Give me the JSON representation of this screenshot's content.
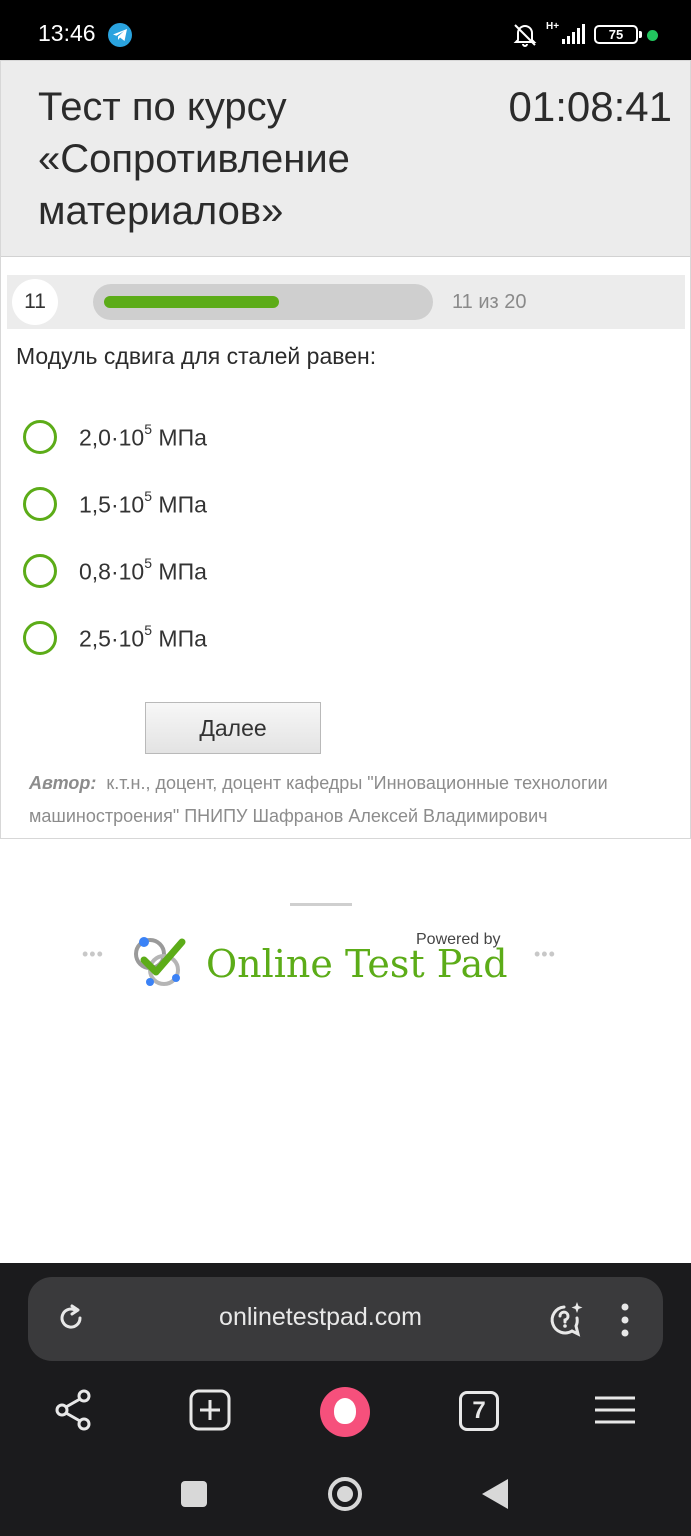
{
  "status_bar": {
    "time": "13:46",
    "network": "H+",
    "battery": "75",
    "icons": [
      "telegram-icon",
      "bell-muted-icon",
      "signal-icon",
      "battery-icon"
    ]
  },
  "test": {
    "title": "Тест по курсу «Сопротивление материалов»",
    "timer": "01:08:41",
    "question_number": "11",
    "progress_text": "11 из 20",
    "progress_fraction": 0.55,
    "question": "Модуль сдвига для сталей равен:",
    "answers": [
      {
        "mantissa": "2,0·10",
        "exponent": "5",
        "unit": " МПа"
      },
      {
        "mantissa": "1,5·10",
        "exponent": "5",
        "unit": " МПа"
      },
      {
        "mantissa": "0,8·10",
        "exponent": "5",
        "unit": " МПа"
      },
      {
        "mantissa": "2,5·10",
        "exponent": "5",
        "unit": " МПа"
      }
    ],
    "next_label": "Далее",
    "author_label": "Автор:",
    "author_text": "к.т.н., доцент, доцент кафедры \"Инновационные технологии машиностроения\" ПНИПУ Шафранов Алексей Владимирович"
  },
  "branding": {
    "powered_by": "Powered by",
    "name": "Online Test Pad",
    "dots": "•••"
  },
  "browser": {
    "url": "onlinetestpad.com",
    "tabs_count": "7"
  },
  "colors": {
    "accent": "#5cac18",
    "header_bg": "#ececec",
    "browser_bg": "#1b1b1d",
    "alice": "#f6507c"
  }
}
